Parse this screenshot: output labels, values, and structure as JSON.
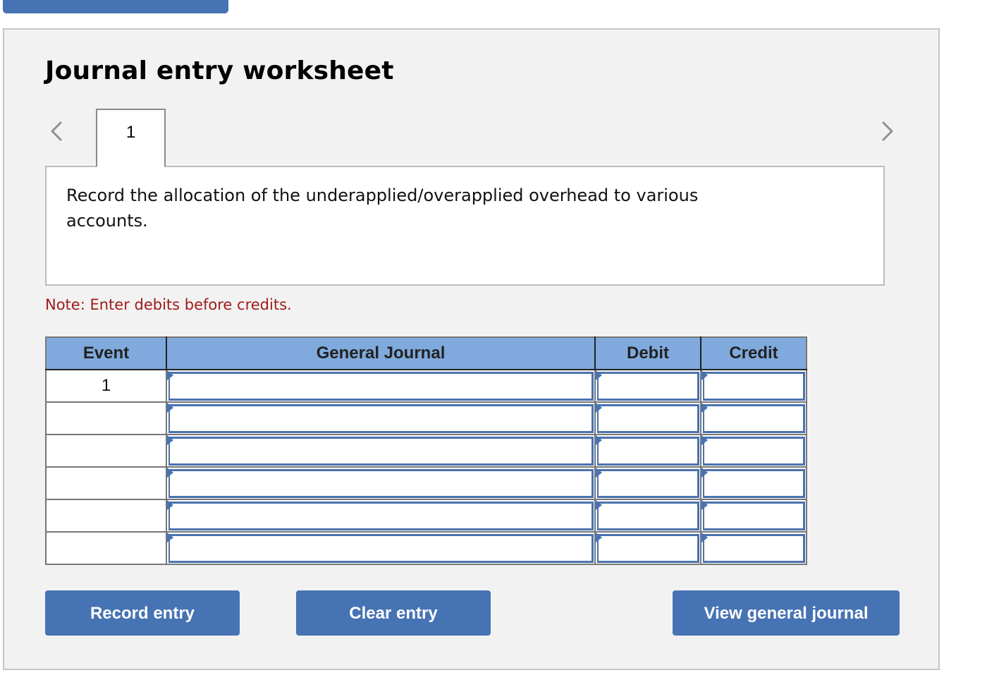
{
  "worksheet": {
    "title": "Journal entry worksheet",
    "tabs": [
      {
        "label": "1",
        "active": true
      }
    ],
    "nav": {
      "prev_icon": "chevron-left-icon",
      "next_icon": "chevron-right-icon"
    },
    "description": "Record the allocation of the underapplied/overapplied overhead to various accounts.",
    "note": "Note: Enter debits before credits.",
    "colors": {
      "accent": "#4673b3",
      "header": "#80aadd",
      "note": "#a11b1b",
      "panel": "#f2f2f2"
    }
  },
  "table": {
    "columns": [
      "Event",
      "General Journal",
      "Debit",
      "Credit"
    ],
    "rows": [
      {
        "event": "1",
        "general_journal": "",
        "debit": "",
        "credit": ""
      },
      {
        "event": "",
        "general_journal": "",
        "debit": "",
        "credit": ""
      },
      {
        "event": "",
        "general_journal": "",
        "debit": "",
        "credit": ""
      },
      {
        "event": "",
        "general_journal": "",
        "debit": "",
        "credit": ""
      },
      {
        "event": "",
        "general_journal": "",
        "debit": "",
        "credit": ""
      },
      {
        "event": "",
        "general_journal": "",
        "debit": "",
        "credit": ""
      }
    ]
  },
  "buttons": {
    "record": "Record entry",
    "clear": "Clear entry",
    "view": "View general journal"
  }
}
